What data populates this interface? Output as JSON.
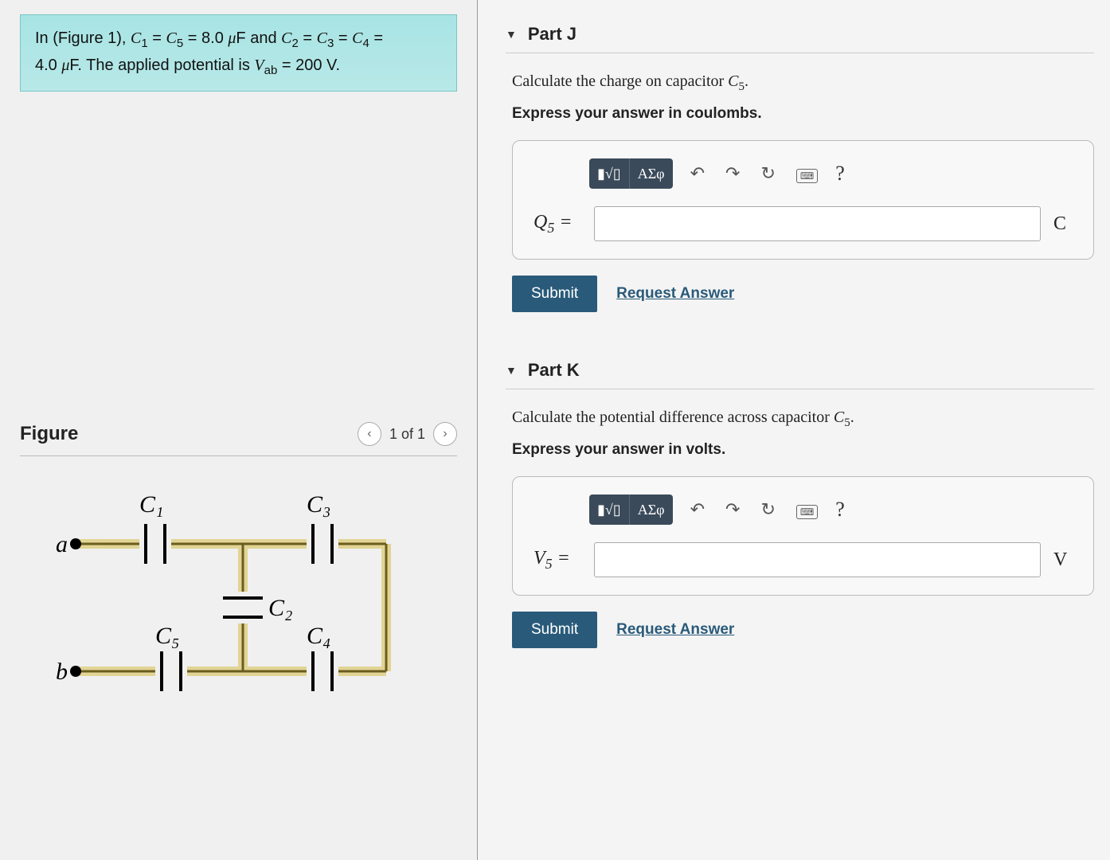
{
  "problem": {
    "line1_html": "In (Figure 1), <i>C</i><span class='sub'>1</span> = <i>C</i><span class='sub'>5</span> = 8.0 <i>μ</i>F and <i>C</i><span class='sub'>2</span> = <i>C</i><span class='sub'>3</span> = <i>C</i><span class='sub'>4</span> =",
    "line2_html": "4.0 <i>μ</i>F. The applied potential is <i>V</i><span class='sub'>ab</span> = 200 V."
  },
  "figure": {
    "title": "Figure",
    "nav_text": "1 of 1",
    "prev": "‹",
    "next": "›",
    "labels": {
      "a": "a",
      "b": "b",
      "C1": "C₁",
      "C2": "C₂",
      "C3": "C₃",
      "C4": "C₄",
      "C5": "C₅"
    }
  },
  "parts": [
    {
      "title": "Part J",
      "prompt_html": "Calculate the charge on capacitor <span class='ital'>C</span><span class='sub'>5</span>.",
      "instruct": "Express your answer in coulombs.",
      "var_label_html": "<i>Q</i><span class='sub'>5</span> =",
      "unit": "C",
      "value": ""
    },
    {
      "title": "Part K",
      "prompt_html": "Calculate the potential difference across capacitor <span class='ital'>C</span><span class='sub'>5</span>.",
      "instruct": "Express your answer in volts.",
      "var_label_html": "<i>V</i><span class='sub'>5</span> =",
      "unit": "V",
      "value": ""
    }
  ],
  "toolbar": {
    "format_btn": "▮√▯",
    "greek_btn": "ΑΣφ",
    "undo": "↶",
    "redo": "↷",
    "reset": "↻",
    "keyboard": "⌨",
    "help": "?"
  },
  "actions": {
    "submit": "Submit",
    "request": "Request Answer"
  }
}
